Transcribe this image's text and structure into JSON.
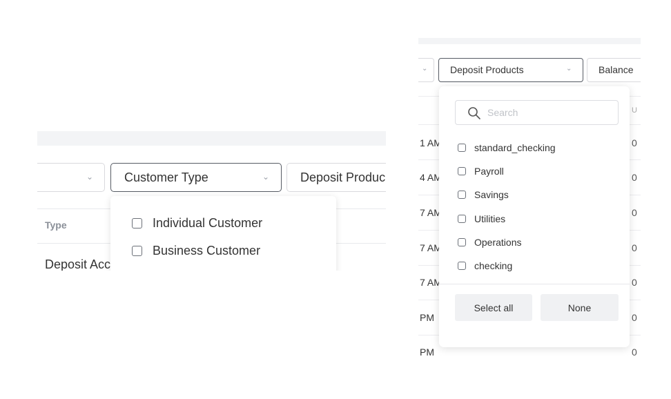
{
  "left_panel": {
    "filters": {
      "customer_type_label": "Customer Type",
      "deposit_products_label": "Deposit Produc"
    },
    "table": {
      "header_type": "Type",
      "cell_type": "Deposit Acc"
    },
    "customer_type_menu": {
      "options": [
        {
          "label": "Individual Customer",
          "checked": false
        },
        {
          "label": "Business Customer",
          "checked": false
        }
      ]
    }
  },
  "right_panel": {
    "filters": {
      "deposit_products_label": "Deposit Products",
      "balance_label": "Balance"
    },
    "table": {
      "right_header": "U",
      "times": [
        "1 AM",
        "4 AM",
        "7 AM",
        "7 AM",
        "7 AM",
        "PM",
        "PM"
      ],
      "right_values": [
        "0",
        "0",
        "0",
        "0",
        "0",
        "0",
        "0"
      ]
    },
    "deposit_products_menu": {
      "search": {
        "placeholder": "Search",
        "value": ""
      },
      "options": [
        {
          "label": "standard_checking",
          "checked": false
        },
        {
          "label": "Payroll",
          "checked": false
        },
        {
          "label": "Savings",
          "checked": false
        },
        {
          "label": "Utilities",
          "checked": false
        },
        {
          "label": "Operations",
          "checked": false
        },
        {
          "label": "checking",
          "checked": false
        }
      ],
      "select_all_label": "Select all",
      "none_label": "None"
    }
  },
  "icons": {
    "chevron": "chevron-down-icon",
    "search": "search-icon",
    "checkbox": "checkbox-unchecked-icon"
  },
  "colors": {
    "strip": "#f3f4f6",
    "active_border": "#555a63",
    "border": "#d9d9dd",
    "button_bg": "#f0f1f3"
  }
}
